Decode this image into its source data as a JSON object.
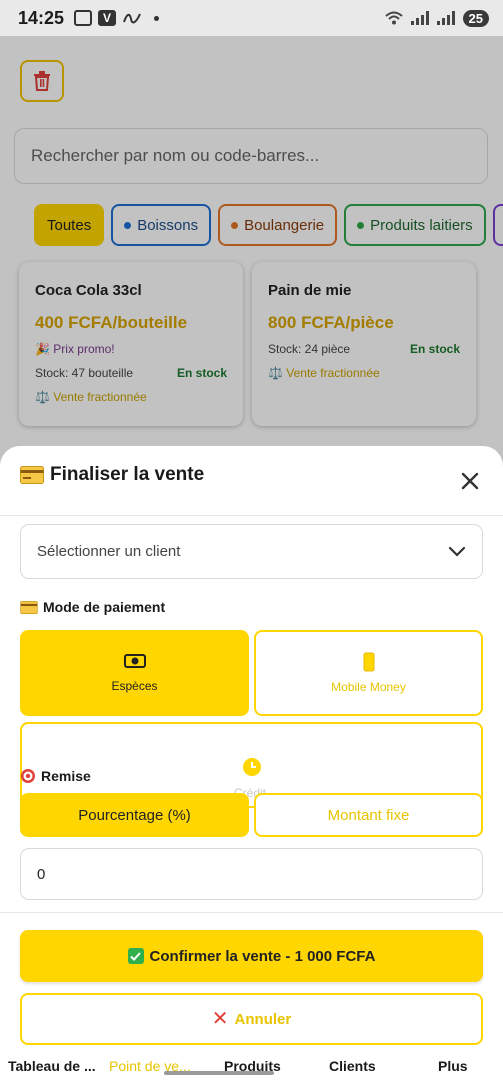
{
  "status_bar": {
    "time": "14:25",
    "battery": "25"
  },
  "background": {
    "search_placeholder": "Rechercher par nom ou code-barres...",
    "categories": [
      {
        "label": "Toutes",
        "color": "#ffd600"
      },
      {
        "label": "Boissons",
        "color": "#1f6fd6"
      },
      {
        "label": "Boulangerie",
        "color": "#e2762a"
      },
      {
        "label": "Produits laitiers",
        "color": "#2ea84a"
      }
    ],
    "products": [
      {
        "name": "Coca Cola 33cl",
        "price": "400 FCFA/bouteille",
        "promo": "🎉 Prix promo!",
        "stock": "Stock: 47 bouteille",
        "availability": "En stock",
        "fraction": "⚖️ Vente fractionnée"
      },
      {
        "name": "Pain de mie",
        "price": "800 FCFA/pièce",
        "stock": "Stock: 24 pièce",
        "availability": "En stock",
        "fraction": "⚖️ Vente fractionnée"
      }
    ]
  },
  "sheet": {
    "title": "Finaliser la vente",
    "client_select": "Sélectionner un client",
    "payment_label": "Mode de paiement",
    "payment_methods": {
      "cash": "Espèces",
      "mobile": "Mobile Money",
      "credit": "Crédit"
    },
    "discount_label": "Remise",
    "discount_types": {
      "percent": "Pourcentage (%)",
      "fixed": "Montant fixe"
    },
    "discount_value": "0",
    "confirm_label": "Confirmer la vente - 1 000 FCFA",
    "cancel_label": "Annuler"
  },
  "nav": {
    "items": [
      "Tableau de ...",
      "Point de ve...",
      "Produits",
      "Clients",
      "Plus"
    ],
    "active": "Point de ve..."
  },
  "colors": {
    "accent": "#ffd600",
    "accent_text": "#e8c400",
    "in_stock": "#1d7a31"
  }
}
